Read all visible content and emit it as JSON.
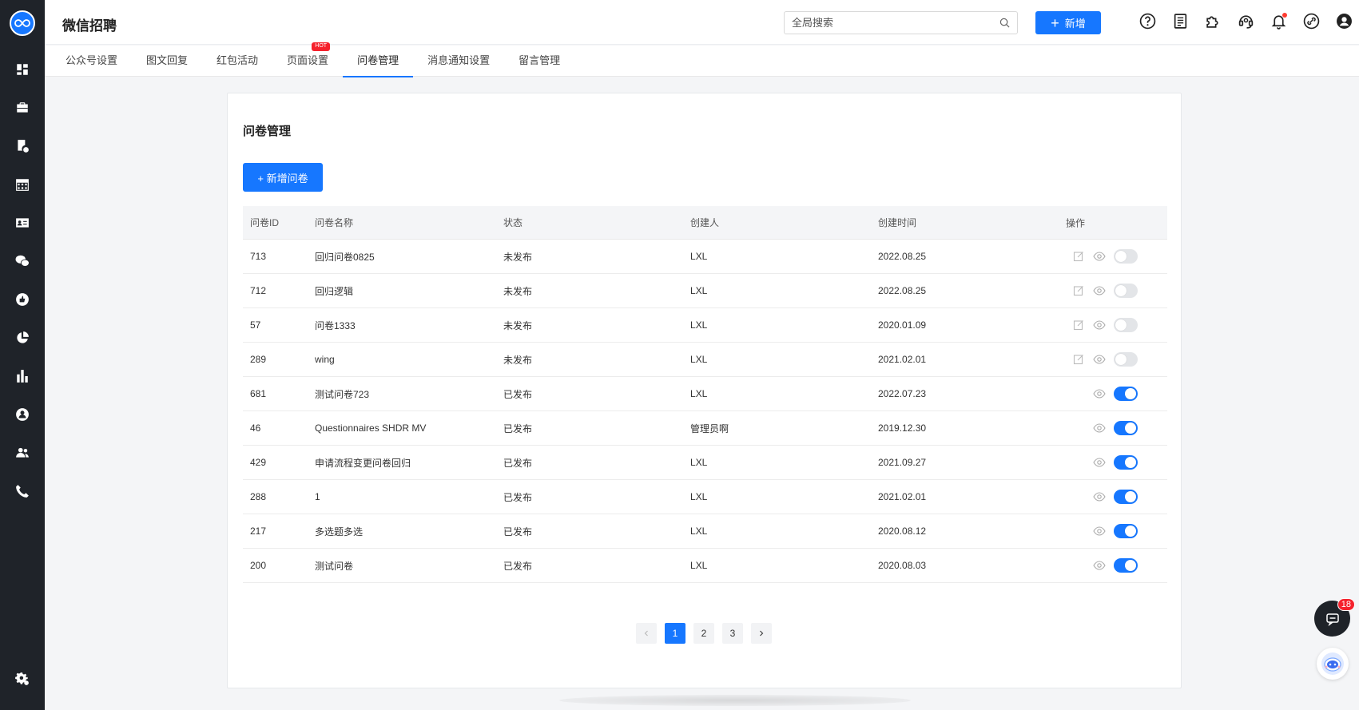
{
  "header": {
    "title": "微信招聘",
    "search_placeholder": "全局搜索",
    "add_label": "新增"
  },
  "header_icons": [
    "help-icon",
    "document-icon",
    "plugin-icon",
    "headset-icon",
    "bell-icon",
    "link-icon",
    "user-icon"
  ],
  "sidebar": {
    "items": [
      "dashboard-icon",
      "briefcase-icon",
      "resume-icon",
      "calendar-icon",
      "id-card-icon",
      "wechat-icon",
      "thumbs-up-icon",
      "pie-chart-icon",
      "bar-chart-icon",
      "employee-icon",
      "team-icon",
      "phone-icon"
    ],
    "bottom": "settings-icon"
  },
  "tabs": [
    {
      "label": "公众号设置",
      "active": false
    },
    {
      "label": "图文回复",
      "active": false
    },
    {
      "label": "红包活动",
      "active": false
    },
    {
      "label": "页面设置",
      "active": false,
      "badge": "HOT"
    },
    {
      "label": "问卷管理",
      "active": true
    },
    {
      "label": "消息通知设置",
      "active": false
    },
    {
      "label": "留言管理",
      "active": false
    }
  ],
  "card": {
    "title": "问卷管理",
    "new_button": "+ 新增问卷"
  },
  "table": {
    "headers": [
      "问卷ID",
      "问卷名称",
      "状态",
      "创建人",
      "创建时间",
      "操作"
    ],
    "rows": [
      {
        "id": "713",
        "name": "回归问卷0825",
        "status": "未发布",
        "creator": "LXL",
        "created": "2022.08.25",
        "published": false
      },
      {
        "id": "712",
        "name": "回归逻辑",
        "status": "未发布",
        "creator": "LXL",
        "created": "2022.08.25",
        "published": false
      },
      {
        "id": "57",
        "name": "问卷1333",
        "status": "未发布",
        "creator": "LXL",
        "created": "2020.01.09",
        "published": false
      },
      {
        "id": "289",
        "name": "wing",
        "status": "未发布",
        "creator": "LXL",
        "created": "2021.02.01",
        "published": false
      },
      {
        "id": "681",
        "name": "测试问卷723",
        "status": "已发布",
        "creator": "LXL",
        "created": "2022.07.23",
        "published": true
      },
      {
        "id": "46",
        "name": "Questionnaires SHDR MV",
        "status": "已发布",
        "creator": "管理员啊",
        "created": "2019.12.30",
        "published": true
      },
      {
        "id": "429",
        "name": "申请流程变更问卷回归",
        "status": "已发布",
        "creator": "LXL",
        "created": "2021.09.27",
        "published": true
      },
      {
        "id": "288",
        "name": "1",
        "status": "已发布",
        "creator": "LXL",
        "created": "2021.02.01",
        "published": true
      },
      {
        "id": "217",
        "name": "多选题多选",
        "status": "已发布",
        "creator": "LXL",
        "created": "2020.08.12",
        "published": true
      },
      {
        "id": "200",
        "name": "测试问卷",
        "status": "已发布",
        "creator": "LXL",
        "created": "2020.08.03",
        "published": true
      }
    ]
  },
  "pagination": {
    "pages": [
      "1",
      "2",
      "3"
    ],
    "current": "1"
  },
  "chat": {
    "badge": "18"
  },
  "colors": {
    "primary": "#1677ff",
    "sidebar": "#1f2329",
    "hot": "#f5222d"
  }
}
